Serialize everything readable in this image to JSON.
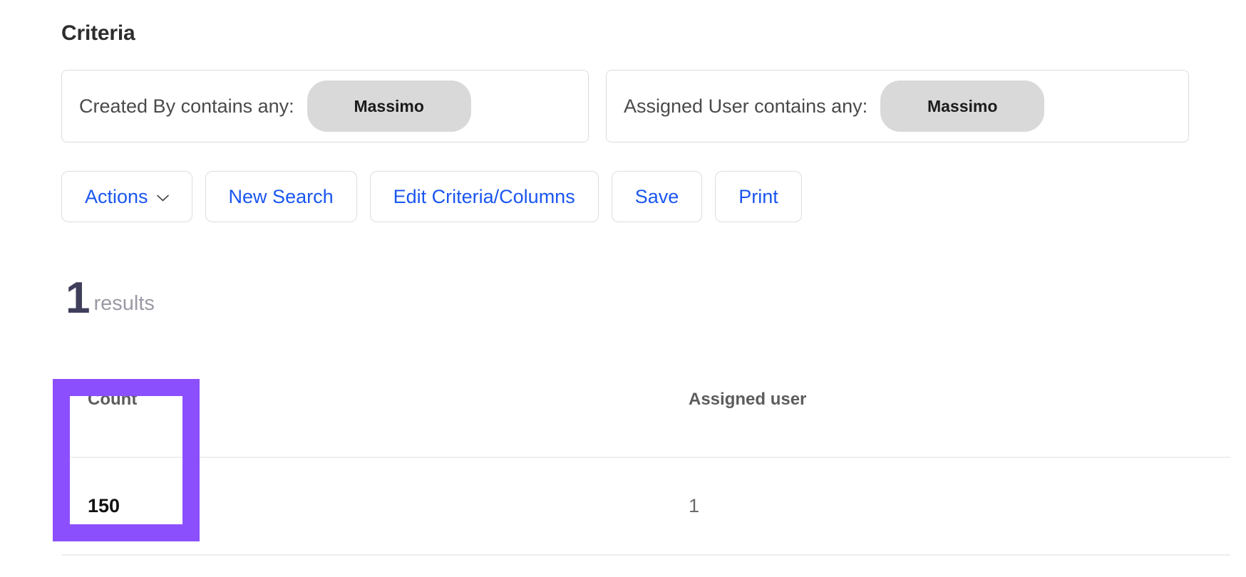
{
  "criteria": {
    "title": "Criteria",
    "filters": [
      {
        "label": "Created By contains any:",
        "chip": "Massimo"
      },
      {
        "label": "Assigned User contains any:",
        "chip": "Massimo"
      }
    ]
  },
  "toolbar": {
    "actions_label": "Actions",
    "actions_icon": "chevron-down-icon",
    "new_search_label": "New Search",
    "edit_criteria_label": "Edit Criteria/Columns",
    "save_label": "Save",
    "print_label": "Print"
  },
  "results": {
    "count": "1",
    "word": "results"
  },
  "table": {
    "columns": [
      "Count",
      "Assigned user"
    ],
    "rows": [
      {
        "count": "150",
        "assigned_user": "1"
      }
    ]
  },
  "annotation": {
    "name": "count-column-highlight",
    "color": "#8c4ffd"
  }
}
